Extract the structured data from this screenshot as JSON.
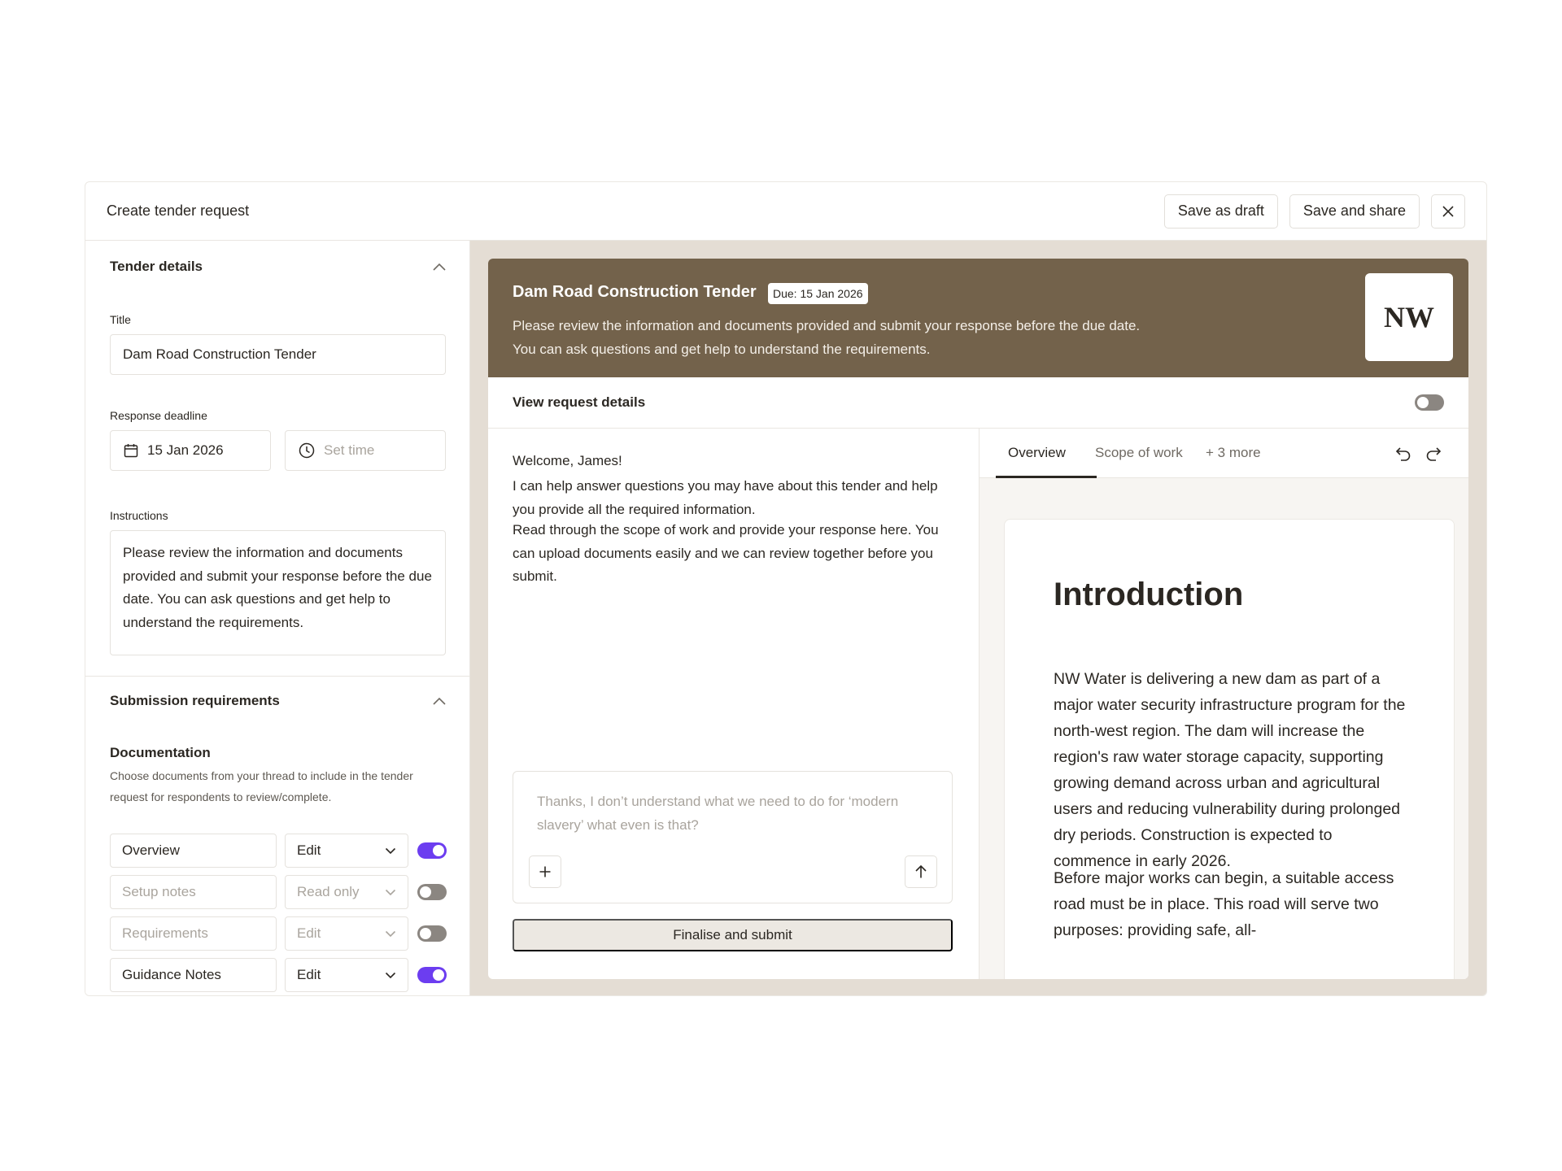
{
  "header": {
    "title": "Create tender request",
    "save_draft_label": "Save as draft",
    "save_share_label": "Save and share",
    "close_icon": "close-icon"
  },
  "tender_details": {
    "heading": "Tender details",
    "title_label": "Title",
    "title_value": "Dam Road Construction Tender",
    "deadline_label": "Response deadline",
    "deadline_date": "15 Jan 2026",
    "deadline_time_placeholder": "Set time",
    "instructions_label": "Instructions",
    "instructions_value": "Please review the information and documents provided and submit your response before the due date. You can ask questions and get help to understand the requirements."
  },
  "submission": {
    "heading": "Submission requirements",
    "documentation_title": "Documentation",
    "documentation_desc": "Choose documents from your thread to include in the tender request for respondents to review/complete.",
    "documents": [
      {
        "name": "Overview",
        "permission": "Edit",
        "enabled": true
      },
      {
        "name": "Setup notes",
        "permission": "Read only",
        "enabled": false
      },
      {
        "name": "Requirements",
        "permission": "Edit",
        "enabled": false
      },
      {
        "name": "Guidance Notes",
        "permission": "Edit",
        "enabled": true
      }
    ]
  },
  "preview": {
    "title": "Dam Road Construction Tender",
    "due_badge": "Due: 15 Jan 2026",
    "description": "Please review the information and documents provided and submit your response before the due date. You can ask questions and get help to understand the requirements.",
    "logo_text": "NW",
    "brand_color": "#73624b",
    "view_details_label": "View request details",
    "view_details_enabled": false
  },
  "chat": {
    "welcome": "Welcome, James!",
    "message_1": "I can help answer questions you may have about this tender and help you provide all the required information.",
    "message_2": "Read through the scope of work and provide your response here. You can upload documents easily and we can review together before you submit.",
    "composer_placeholder": "Thanks, I don’t understand what we need to do for ‘modern slavery’ what even is that?",
    "finalise_label": "Finalise and submit"
  },
  "document_view": {
    "tabs": [
      "Overview",
      "Scope of work",
      "+ 3 more"
    ],
    "active_tab": "Overview",
    "heading": "Introduction",
    "para_1": "NW Water is delivering a new dam as part of a major water security infrastructure program for the north-west region. The dam will increase the region's raw water storage capacity, supporting growing demand across urban and agricultural users and reducing vulnerability during prolonged dry periods. Construction is expected to commence in early 2026.",
    "para_2": "Before major works can begin, a suitable access road must be in place. This road will serve two purposes: providing safe, all-"
  },
  "accent_color": "#6c3df0"
}
